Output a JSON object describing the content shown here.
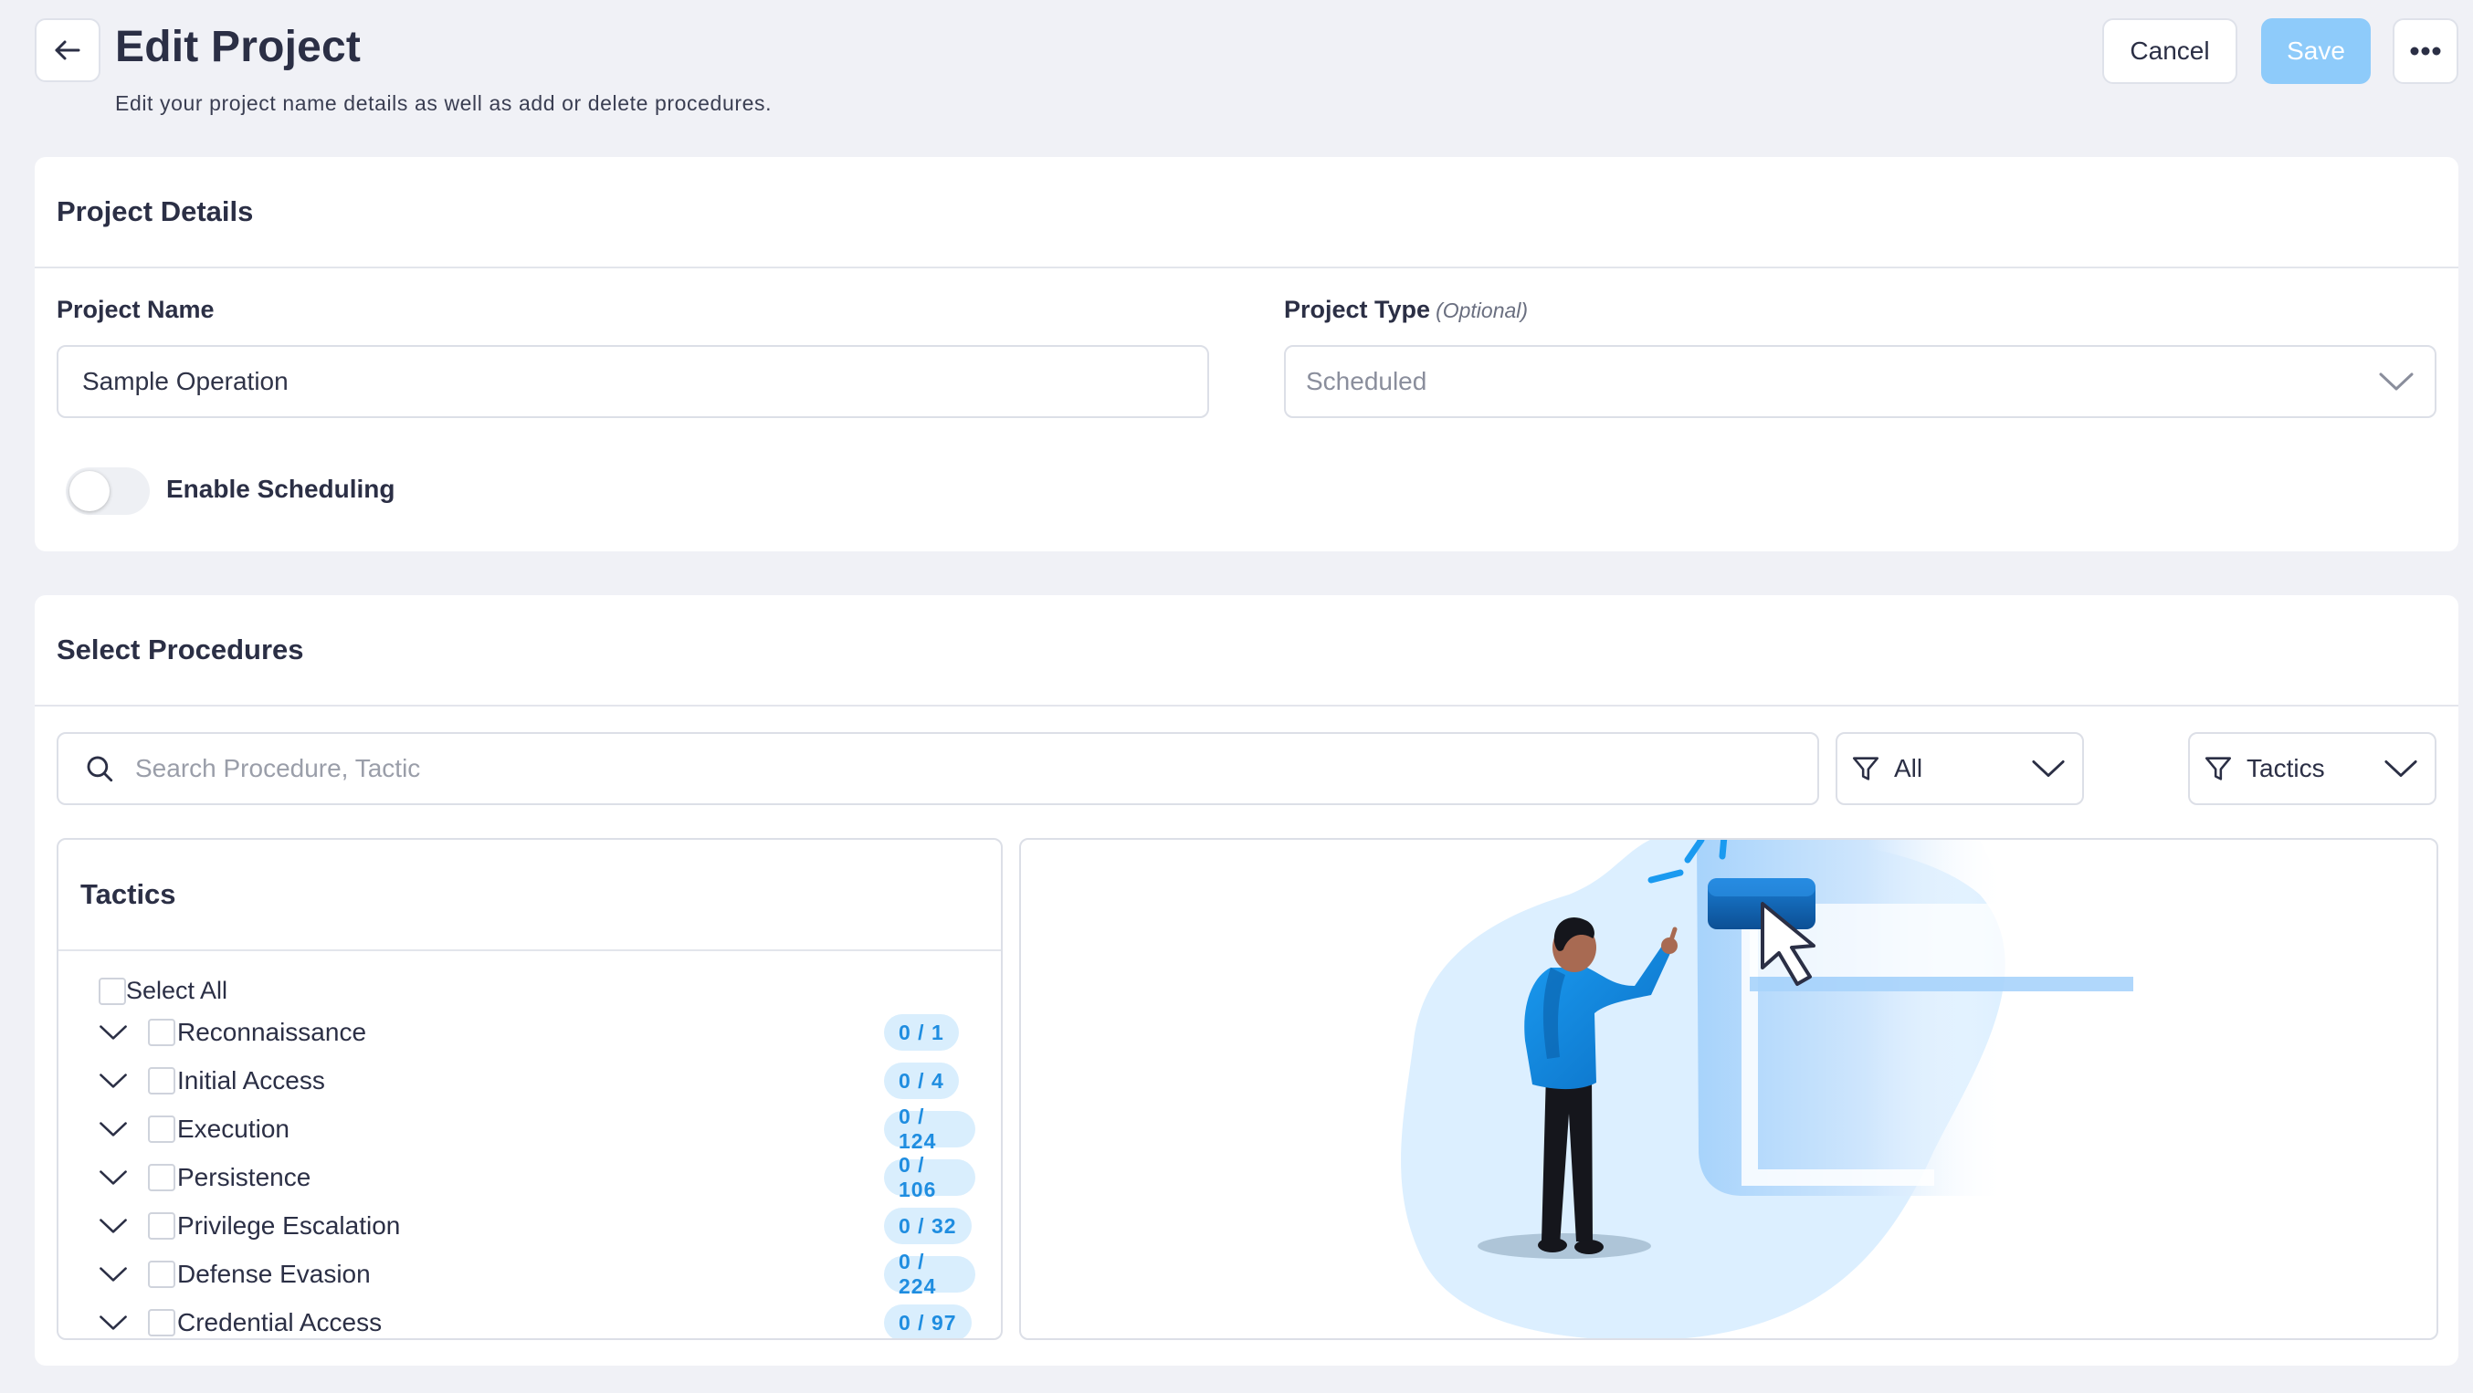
{
  "header": {
    "title": "Edit Project",
    "subtitle": "Edit your project name details as well as add or delete procedures.",
    "cancel_label": "Cancel",
    "save_label": "Save"
  },
  "details": {
    "title": "Project Details",
    "name_label": "Project Name",
    "name_value": "Sample Operation",
    "type_label": "Project Type",
    "type_optional": "(Optional)",
    "type_value": "Scheduled",
    "scheduling_label": "Enable Scheduling",
    "scheduling_enabled": false
  },
  "procedures": {
    "title": "Select Procedures",
    "search_placeholder": "Search Procedure, Tactic",
    "filter_all": "All",
    "filter_tactics": "Tactics",
    "tactics_title": "Tactics",
    "select_all": "Select All",
    "tactics": [
      {
        "name": "Reconnaissance",
        "count": "0 / 1"
      },
      {
        "name": "Initial Access",
        "count": "0 / 4"
      },
      {
        "name": "Execution",
        "count": "0 / 124"
      },
      {
        "name": "Persistence",
        "count": "0 / 106"
      },
      {
        "name": "Privilege Escalation",
        "count": "0 / 32"
      },
      {
        "name": "Defense Evasion",
        "count": "0 / 224"
      },
      {
        "name": "Credential Access",
        "count": "0 / 97"
      }
    ]
  },
  "colors": {
    "accent": "#1f8de0",
    "badge_bg": "#d9eefd",
    "save_disabled": "#8ecbfa",
    "page_bg": "#f0f1f6"
  }
}
